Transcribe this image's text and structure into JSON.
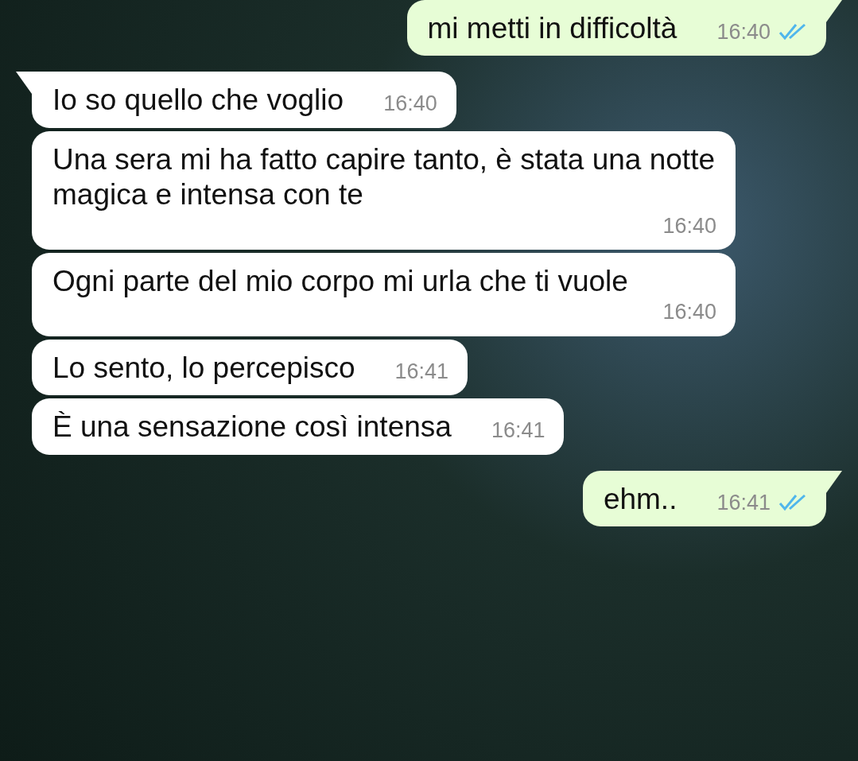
{
  "messages": [
    {
      "kind": "sent",
      "text": "mi metti in difficoltà",
      "time": "16:40",
      "tail": true,
      "read": true
    },
    {
      "kind": "received",
      "text": "Io so quello che voglio",
      "time": "16:40",
      "tail": true
    },
    {
      "kind": "received",
      "text": "Una sera mi ha fatto capire tanto, è stata una notte magica e intensa con te",
      "time": "16:40",
      "tail": false
    },
    {
      "kind": "received",
      "text": "Ogni parte del mio corpo mi urla che ti vuole",
      "time": "16:40",
      "tail": false
    },
    {
      "kind": "received",
      "text": "Lo sento, lo percepisco",
      "time": "16:41",
      "tail": false
    },
    {
      "kind": "received",
      "text": "È una sensazione così intensa",
      "time": "16:41",
      "tail": false
    },
    {
      "kind": "sent",
      "text": "ehm..",
      "time": "16:41",
      "tail": true,
      "read": true
    }
  ]
}
